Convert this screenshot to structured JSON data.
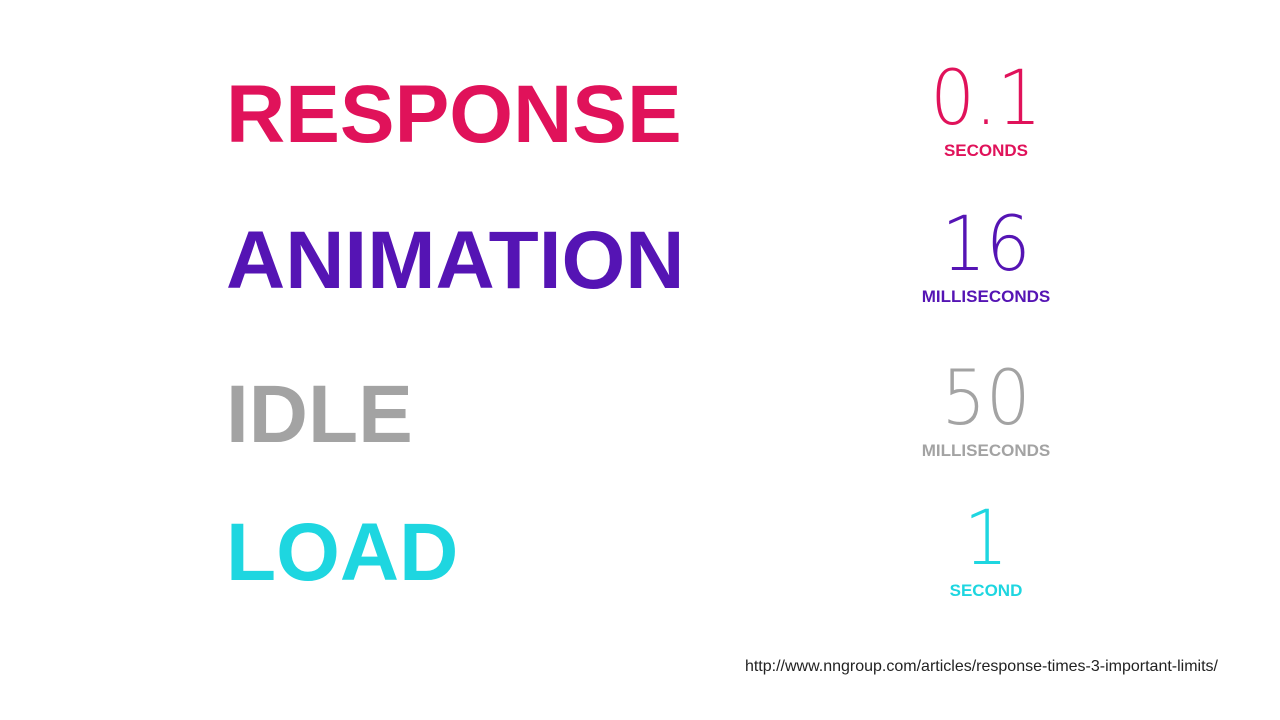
{
  "rows": [
    {
      "label": "RESPONSE",
      "value": "0.1",
      "unit": "SECONDS",
      "color": "#e0125a"
    },
    {
      "label": "ANIMATION",
      "value": "16",
      "unit": "MILLISECONDS",
      "color": "#5514b4"
    },
    {
      "label": "IDLE",
      "value": "50",
      "unit": "MILLISECONDS",
      "color": "#a3a3a3"
    },
    {
      "label": "LOAD",
      "value": "1",
      "unit": "SECOND",
      "color": "#1ed6e0"
    }
  ],
  "source_url": "http://www.nngroup.com/articles/response-times-3-important-limits/"
}
